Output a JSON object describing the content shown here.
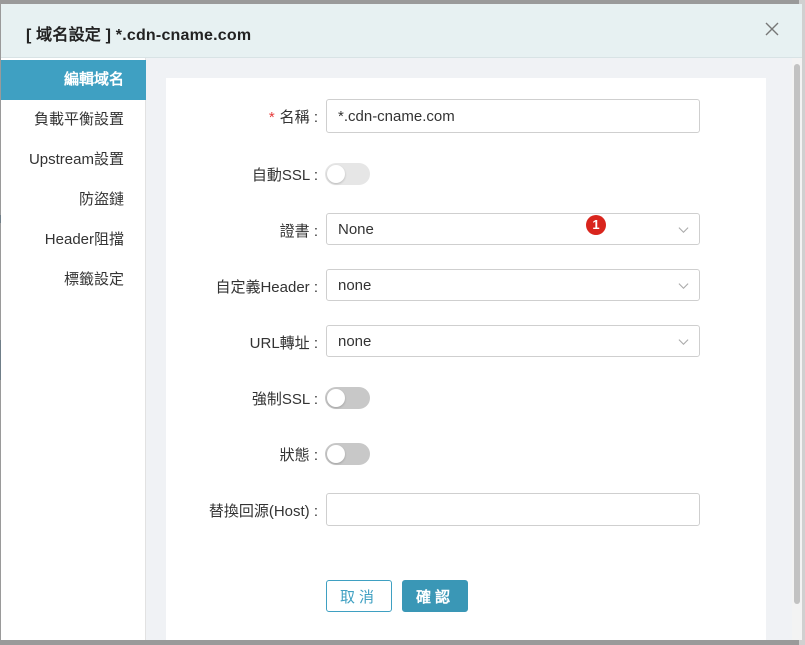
{
  "dialog": {
    "title": "[ 域名設定 ] *.cdn-cname.com"
  },
  "sidebar": {
    "items": [
      {
        "label": "編輯域名",
        "active": true
      },
      {
        "label": "負載平衡設置",
        "active": false
      },
      {
        "label": "Upstream設置",
        "active": false
      },
      {
        "label": "防盜鏈",
        "active": false
      },
      {
        "label": "Header阻擋",
        "active": false
      },
      {
        "label": "標籤設定",
        "active": false
      }
    ]
  },
  "form": {
    "name": {
      "label": "名稱 :",
      "required_mark": "*",
      "value": "*.cdn-cname.com"
    },
    "auto_ssl": {
      "label": "自動SSL :",
      "enabled": false
    },
    "certificate": {
      "label": "證書 :",
      "value": "None",
      "badge": "1"
    },
    "custom_header": {
      "label": "自定義Header :",
      "value": "none"
    },
    "url_redirect": {
      "label": "URL轉址 :",
      "value": "none"
    },
    "force_ssl": {
      "label": "強制SSL :",
      "enabled": false
    },
    "status": {
      "label": "狀態 :",
      "enabled": false
    },
    "host_override": {
      "label": "替換回源(Host) :",
      "value": ""
    }
  },
  "buttons": {
    "cancel": "取消",
    "confirm": "確認"
  },
  "colors": {
    "accent": "#3fa0c2",
    "confirm_bg": "#3a97b6",
    "badge": "#d9251d",
    "toggle_off": "#c8c8c8",
    "toggle_off_light": "#e8e8e8"
  }
}
